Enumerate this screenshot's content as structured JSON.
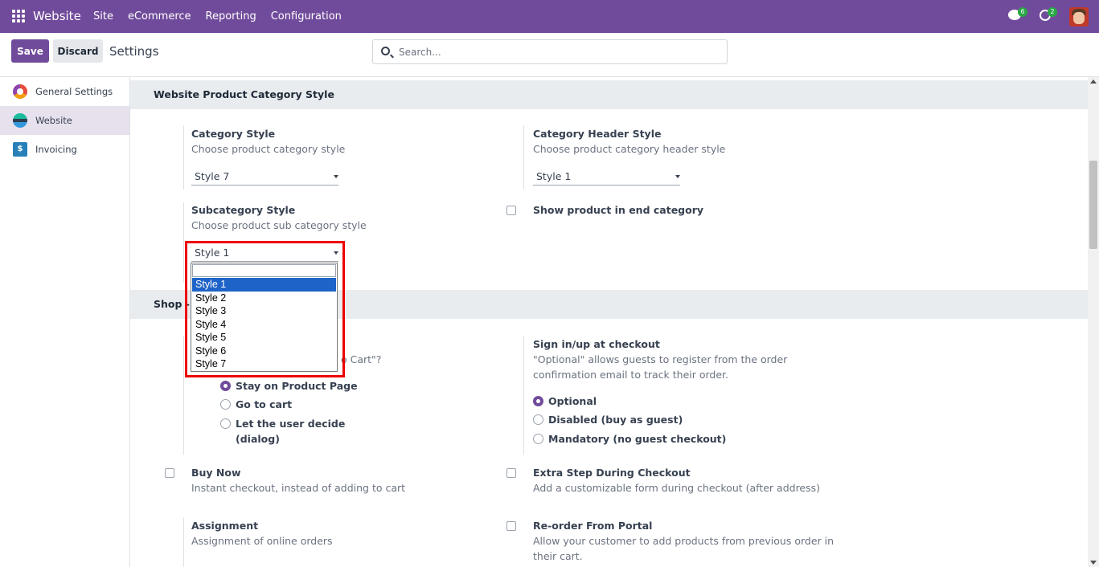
{
  "navbar": {
    "brand": "Website",
    "menu": [
      "Site",
      "eCommerce",
      "Reporting",
      "Configuration"
    ],
    "chat_count": "6",
    "activity_count": "2",
    "color": "#714B9B"
  },
  "control": {
    "save_label": "Save",
    "discard_label": "Discard",
    "breadcrumb": "Settings",
    "search_placeholder": "Search..."
  },
  "sidebar": {
    "items": [
      {
        "label": "General Settings",
        "icon": "odoo-general-icon"
      },
      {
        "label": "Website",
        "icon": "website-app-icon",
        "active": true
      },
      {
        "label": "Invoicing",
        "icon": "invoicing-app-icon"
      }
    ]
  },
  "category_section": {
    "title": "Website Product Category Style",
    "category_style": {
      "label": "Category Style",
      "desc": "Choose product category style",
      "value": "Style 7"
    },
    "category_header_style": {
      "label": "Category Header Style",
      "desc": "Choose product category header style",
      "value": "Style 1"
    },
    "subcategory_style": {
      "label": "Subcategory Style",
      "desc": "Choose product sub category style",
      "value": "Style 1"
    },
    "show_product_end": {
      "label": "Show product in end category",
      "checked": false
    }
  },
  "dropdown": {
    "options": [
      "Style 1",
      "Style 2",
      "Style 3",
      "Style 4",
      "Style 5",
      "Style 6",
      "Style 7"
    ],
    "selected": "Style 1"
  },
  "shop_section": {
    "title_visible": "Shop - C",
    "add_to_cart_desc_visible": "o Cart\"?",
    "add_to_cart_options": [
      {
        "label": "Stay on Product Page",
        "checked": true
      },
      {
        "label": "Go to cart",
        "checked": false
      },
      {
        "label": "Let the user decide",
        "checked": false
      },
      {
        "label": "(dialog)",
        "checked": false
      }
    ],
    "sign_in": {
      "label": "Sign in/up at checkout",
      "desc_line1": "\"Optional\" allows guests to register from the order",
      "desc_line2": "confirmation email to track their order.",
      "options": [
        {
          "label": "Optional",
          "checked": true
        },
        {
          "label": "Disabled (buy as guest)",
          "checked": false
        },
        {
          "label": "Mandatory (no guest checkout)",
          "checked": false
        }
      ]
    },
    "buy_now": {
      "label": "Buy Now",
      "desc": "Instant checkout, instead of adding to cart",
      "checked": false
    },
    "extra_step": {
      "label": "Extra Step During Checkout",
      "desc": "Add a customizable form during checkout (after address)",
      "checked": false
    },
    "assignment": {
      "label": "Assignment",
      "desc": "Assignment of online orders"
    },
    "reorder": {
      "label": "Re-order From Portal",
      "desc_line1": "Allow your customer to add products from previous order in",
      "desc_line2": "their cart.",
      "checked": false
    }
  }
}
